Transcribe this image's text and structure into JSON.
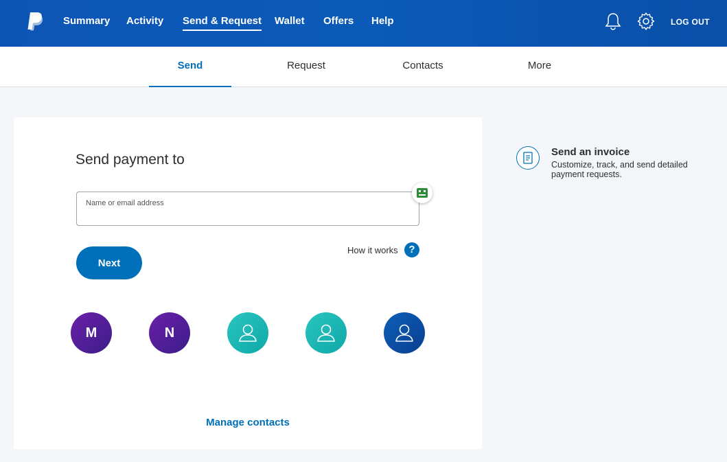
{
  "nav": {
    "items": [
      {
        "label": "Summary"
      },
      {
        "label": "Activity"
      },
      {
        "label": "Send & Request"
      },
      {
        "label": "Wallet"
      },
      {
        "label": "Offers"
      },
      {
        "label": "Help"
      }
    ],
    "active": "Send & Request",
    "logout_label": "LOG OUT",
    "icons": [
      "notification-bell-icon",
      "settings-gear-icon"
    ]
  },
  "subnav": {
    "tabs": [
      {
        "label": "Send"
      },
      {
        "label": "Request"
      },
      {
        "label": "Contacts"
      },
      {
        "label": "More"
      }
    ],
    "active": "Send"
  },
  "send": {
    "title": "Send payment to",
    "input_label": "Name or email address",
    "input_value": "",
    "next_label": "Next",
    "how_it_works": "How it works",
    "help_icon": "?",
    "contacts": [
      {
        "initials": "M",
        "style": "purple"
      },
      {
        "initials": "N",
        "style": "purple"
      },
      {
        "icon": "person-icon",
        "style": "teal"
      },
      {
        "icon": "person-icon",
        "style": "teal"
      },
      {
        "icon": "person-icon",
        "style": "blue"
      }
    ],
    "manage_contacts": "Manage contacts"
  },
  "invoice": {
    "title": "Send an invoice",
    "description": "Customize, track, and send detailed payment requests."
  },
  "colors": {
    "brand_blue": "#0070ba",
    "header_blue": "#0d55b5",
    "background": "#f4f6f9"
  }
}
